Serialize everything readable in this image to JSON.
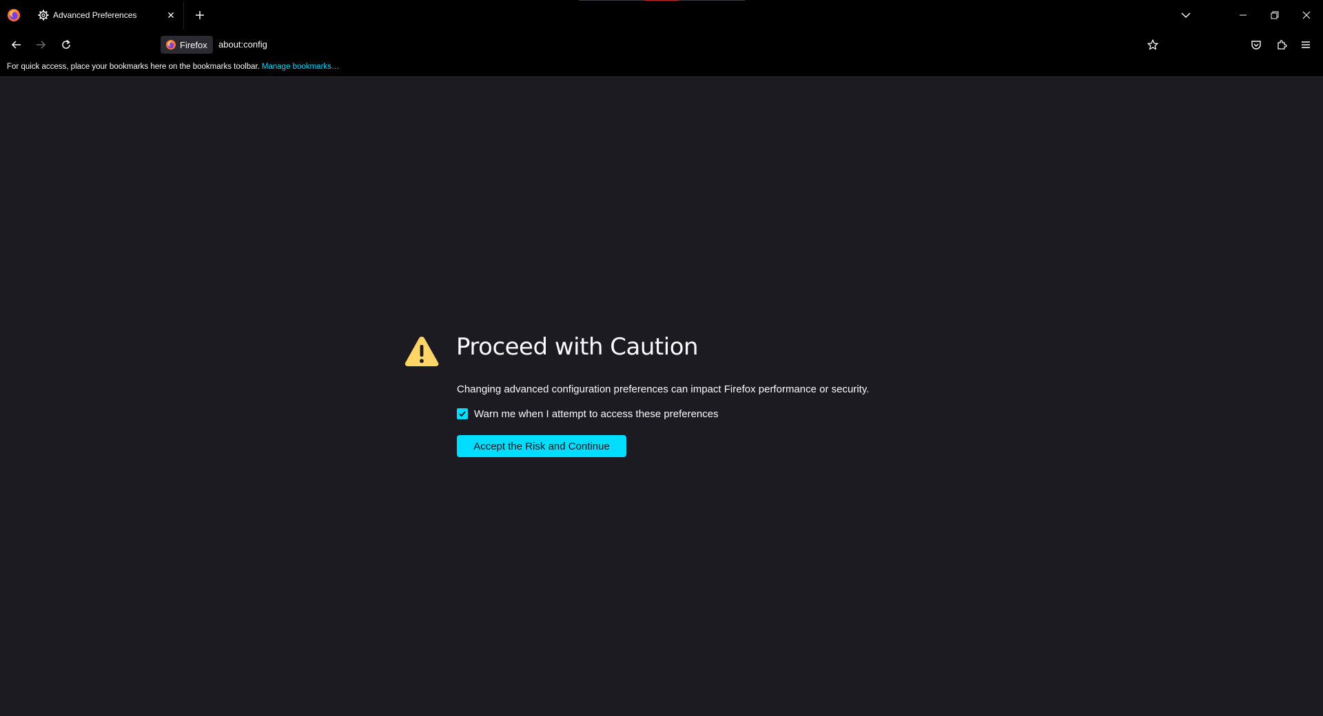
{
  "browser": {
    "tab": {
      "title": "Advanced Preferences",
      "icon": "gear-icon"
    },
    "identity_label": "Firefox",
    "url": "about:config",
    "bookmarks_notice": {
      "text": "For quick access, place your bookmarks here on the bookmarks toolbar.",
      "link": "Manage bookmarks…"
    }
  },
  "page": {
    "title": "Proceed with Caution",
    "description": "Changing advanced configuration preferences can impact Firefox performance or security.",
    "warn_checkbox": {
      "label": "Warn me when I attempt to access these preferences",
      "checked": true
    },
    "accept_button": "Accept the Risk and Continue"
  },
  "colors": {
    "toolbar_bg": "#000000",
    "content_bg": "#1c1b22",
    "accent": "#00ddff",
    "warning": "#ffd567",
    "text": "#fbfbfe"
  }
}
